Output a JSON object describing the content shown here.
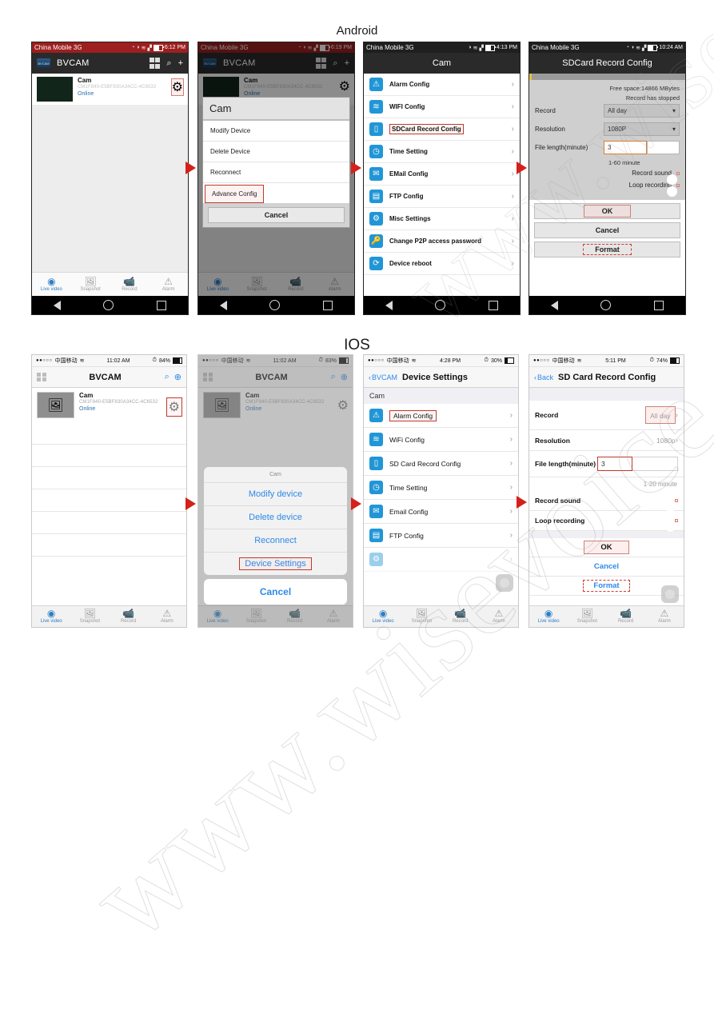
{
  "sections": {
    "android": "Android",
    "ios": "IOS"
  },
  "watermark": {
    "line1": "www.wisevoice.com.cn",
    "line2": "www.wisevoice.com.cn"
  },
  "common": {
    "app_name": "BVCAM",
    "device_name": "Cam",
    "device_id": "CM1F840-E5BF830A34CC-4C6532",
    "device_status": "Online",
    "tabs": [
      {
        "label": "Live video",
        "icon": "live-video-icon"
      },
      {
        "label": "Snapshot",
        "icon": "snapshot-icon"
      },
      {
        "label": "Record",
        "icon": "record-icon"
      },
      {
        "label": "Alarm",
        "icon": "alarm-icon"
      }
    ]
  },
  "android": {
    "screen1": {
      "status": {
        "carrier": "China Mobile 3G",
        "time": "6:12 PM"
      },
      "title": "BVCAM",
      "icons": [
        "grid-icon",
        "search-icon",
        "plus-icon"
      ]
    },
    "screen2": {
      "status": {
        "carrier": "China Mobile 3G",
        "time": "6:19 PM"
      },
      "title": "BVCAM",
      "dialog_title": "Cam",
      "dialog_items": [
        "Modify Device",
        "Delete Device",
        "Reconnect",
        "Advance Config"
      ],
      "cancel": "Cancel"
    },
    "screen3": {
      "status": {
        "carrier": "China Mobile 3G",
        "time": "4:13 PM"
      },
      "title": "Cam",
      "items": [
        {
          "label": "Alarm Config",
          "icon": "alarm-warning-icon"
        },
        {
          "label": "WIFI Config",
          "icon": "wifi-icon"
        },
        {
          "label": "SDCard Record Config",
          "icon": "sdcard-icon"
        },
        {
          "label": "Time Setting",
          "icon": "clock-icon"
        },
        {
          "label": "EMail Config",
          "icon": "mail-icon"
        },
        {
          "label": "FTP Config",
          "icon": "ftp-icon"
        },
        {
          "label": "Misc Settings",
          "icon": "gear-icon"
        },
        {
          "label": "Change P2P access password",
          "icon": "key-icon"
        },
        {
          "label": "Device reboot",
          "icon": "reboot-icon"
        }
      ]
    },
    "screen4": {
      "status": {
        "carrier": "China Mobile 3G",
        "time": "10:24 AM"
      },
      "title": "SDCard Record Config",
      "free_space": "Free space:14866 MBytes",
      "record_state": "Record has stopped",
      "record_label": "Record",
      "record_value": "All day",
      "resolution_label": "Resolution",
      "resolution_value": "1080P",
      "file_length_label": "File length(minute)",
      "file_length_value": "3",
      "file_length_hint": "1-60 minute",
      "record_sound_label": "Record sound",
      "record_sound_on": true,
      "loop_recording_label": "Loop recording",
      "loop_recording_on": true,
      "ok": "OK",
      "cancel": "Cancel",
      "format": "Format"
    }
  },
  "ios": {
    "screen1": {
      "status": {
        "carrier": "中国移动",
        "time": "11:02 AM",
        "battery": "84%"
      },
      "title": "BVCAM"
    },
    "screen2": {
      "status": {
        "carrier": "中国移动",
        "time": "11:02 AM",
        "battery": "83%"
      },
      "title": "BVCAM",
      "sheet_title": "Cam",
      "sheet_items": [
        "Modify device",
        "Delete device",
        "Reconnect",
        "Device Settings"
      ],
      "cancel": "Cancel"
    },
    "screen3": {
      "status": {
        "carrier": "中国移动",
        "time": "4:28 PM",
        "battery": "30%"
      },
      "back": "BVCAM",
      "title": "Device Settings",
      "group_header": "Cam",
      "items": [
        {
          "label": "Alarm Config",
          "icon": "alarm-warning-icon"
        },
        {
          "label": "WiFi Config",
          "icon": "wifi-icon"
        },
        {
          "label": "SD Card Record Config",
          "icon": "sdcard-icon"
        },
        {
          "label": "Time Setting",
          "icon": "clock-icon"
        },
        {
          "label": "Email Config",
          "icon": "mail-icon"
        },
        {
          "label": "FTP Config",
          "icon": "ftp-icon"
        }
      ]
    },
    "screen4": {
      "status": {
        "carrier": "中国移动",
        "time": "5:11 PM",
        "battery": "74%"
      },
      "back": "Back",
      "title": "SD Card Record Config",
      "record_label": "Record",
      "record_value": "All day",
      "resolution_label": "Resolution",
      "resolution_value": "1080p",
      "file_length_label": "File length(minute)",
      "file_length_value": "3",
      "file_length_hint": "1-20 minute",
      "record_sound_label": "Record sound",
      "loop_recording_label": "Loop recording",
      "ok": "OK",
      "cancel": "Cancel",
      "format": "Format"
    }
  }
}
